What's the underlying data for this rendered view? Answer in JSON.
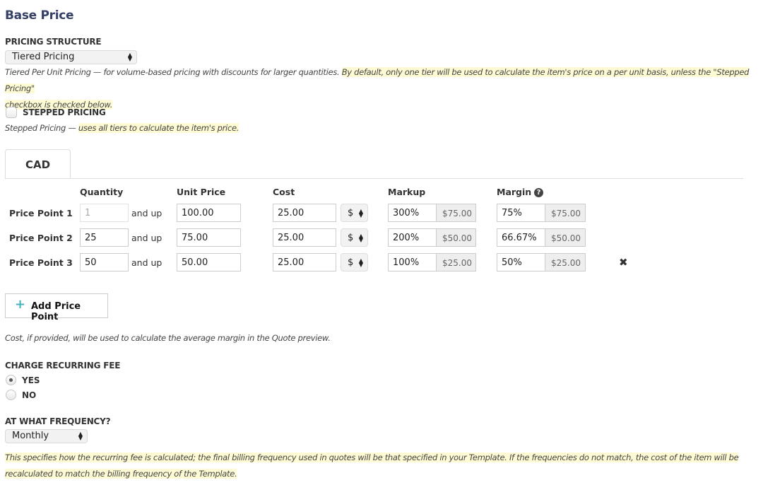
{
  "title": "Base Price",
  "pricing_structure": {
    "label": "PRICING STRUCTURE",
    "selected": "Tiered Pricing",
    "help_plain": "Tiered Per Unit Pricing — for volume-based pricing with discounts for larger quantities. ",
    "help_highlight_line1": "By default, only one tier will be used to calculate the item's price on a per unit basis, unless the \"Stepped Pricing\"",
    "help_highlight_line2": "checkbox is checked below."
  },
  "stepped_pricing": {
    "label": "STEPPED PRICING",
    "checked": false,
    "help_plain": "Stepped Pricing — ",
    "help_highlight": "uses all tiers to calculate the item's price."
  },
  "currency_tab": {
    "label": "CAD"
  },
  "table": {
    "headers": {
      "quantity": "Quantity",
      "unit_price": "Unit Price",
      "cost": "Cost",
      "markup": "Markup",
      "margin": "Margin"
    },
    "and_up": "and up",
    "rows": [
      {
        "label": "Price Point 1",
        "quantity": "1",
        "unit_price": "100.00",
        "cost": "25.00",
        "cost_unit": "$",
        "markup": "300%",
        "markup_amount": "$75.00",
        "margin": "75%",
        "margin_amount": "$75.00",
        "removable": false
      },
      {
        "label": "Price Point 2",
        "quantity": "25",
        "unit_price": "75.00",
        "cost": "25.00",
        "cost_unit": "$",
        "markup": "200%",
        "markup_amount": "$50.00",
        "margin": "66.67%",
        "margin_amount": "$50.00",
        "removable": false
      },
      {
        "label": "Price Point 3",
        "quantity": "50",
        "unit_price": "50.00",
        "cost": "25.00",
        "cost_unit": "$",
        "markup": "100%",
        "markup_amount": "$25.00",
        "margin": "50%",
        "margin_amount": "$25.00",
        "removable": true
      }
    ]
  },
  "add_price_point": {
    "label": "Add Price Point",
    "icon": "plus-icon"
  },
  "cost_note": "Cost, if provided, will be used to calculate the average margin in the Quote preview.",
  "recurring_fee": {
    "label": "CHARGE RECURRING FEE",
    "options": [
      {
        "label": "YES",
        "selected": true
      },
      {
        "label": "NO",
        "selected": false
      }
    ]
  },
  "frequency": {
    "label": "AT WHAT FREQUENCY?",
    "selected": "Monthly",
    "help_line1": "This specifies how the recurring fee is calculated; the final billing frequency used in quotes will be that specified in your Template. If the frequencies do not match, the cost of the item will be",
    "help_line2": "recalculated to match the billing frequency of the Template."
  },
  "icons": {
    "help": "?",
    "remove": "✖",
    "plus": "+",
    "select_arrows": "▲▼"
  },
  "colors": {
    "title": "#344066",
    "highlight": "#fefbd4",
    "add_icon": "#48b0bd"
  }
}
